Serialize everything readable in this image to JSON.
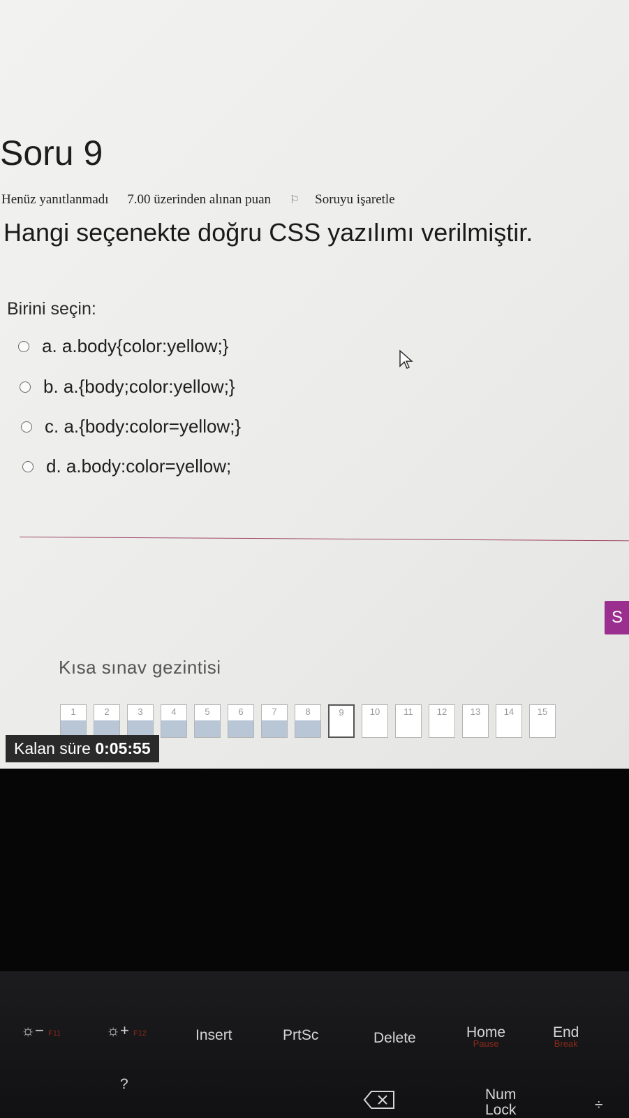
{
  "question": {
    "title": "Soru 9",
    "status": "Henüz yanıtlanmadı",
    "points": "7.00 üzerinden alınan puan",
    "flag_label": "Soruyu işaretle",
    "text": "Hangi seçenekte doğru CSS yazılımı verilmiştir.",
    "prompt": "Birini seçin:",
    "options": [
      {
        "label": "a. a.body{color:yellow;}"
      },
      {
        "label": "b. a.{body;color:yellow;}"
      },
      {
        "label": "c. a.{body:color=yellow;}"
      },
      {
        "label": "d. a.body:color=yellow;"
      }
    ]
  },
  "next_button_label": "S",
  "navigation": {
    "title": "Kısa sınav gezintisi",
    "items": [
      {
        "num": "1",
        "state": "answered"
      },
      {
        "num": "2",
        "state": "answered"
      },
      {
        "num": "3",
        "state": "answered"
      },
      {
        "num": "4",
        "state": "answered"
      },
      {
        "num": "5",
        "state": "answered"
      },
      {
        "num": "6",
        "state": "answered"
      },
      {
        "num": "7",
        "state": "answered"
      },
      {
        "num": "8",
        "state": "answered"
      },
      {
        "num": "9",
        "state": "current"
      },
      {
        "num": "10",
        "state": "unanswered"
      },
      {
        "num": "11",
        "state": "unanswered"
      },
      {
        "num": "12",
        "state": "unanswered"
      },
      {
        "num": "13",
        "state": "unanswered"
      },
      {
        "num": "14",
        "state": "unanswered"
      },
      {
        "num": "15",
        "state": "unanswered"
      }
    ]
  },
  "timer": {
    "label": "Kalan süre",
    "value": "0:05:55"
  },
  "keyboard": {
    "f11": "☼−",
    "f11_sub": "F11",
    "f12": "☼+",
    "f12_sub": "F12",
    "insert": "Insert",
    "prtsc": "PrtSc",
    "delete": "Delete",
    "home": "Home",
    "home_sub": "Pause",
    "end": "End",
    "end_sub": "Break",
    "numlock_1": "Num",
    "numlock_2": "Lock",
    "question_key": "?",
    "divide": "÷"
  },
  "colors": {
    "accent": "#9b2f8f",
    "answered": "#b8c6d6",
    "divider": "#a0486b"
  }
}
